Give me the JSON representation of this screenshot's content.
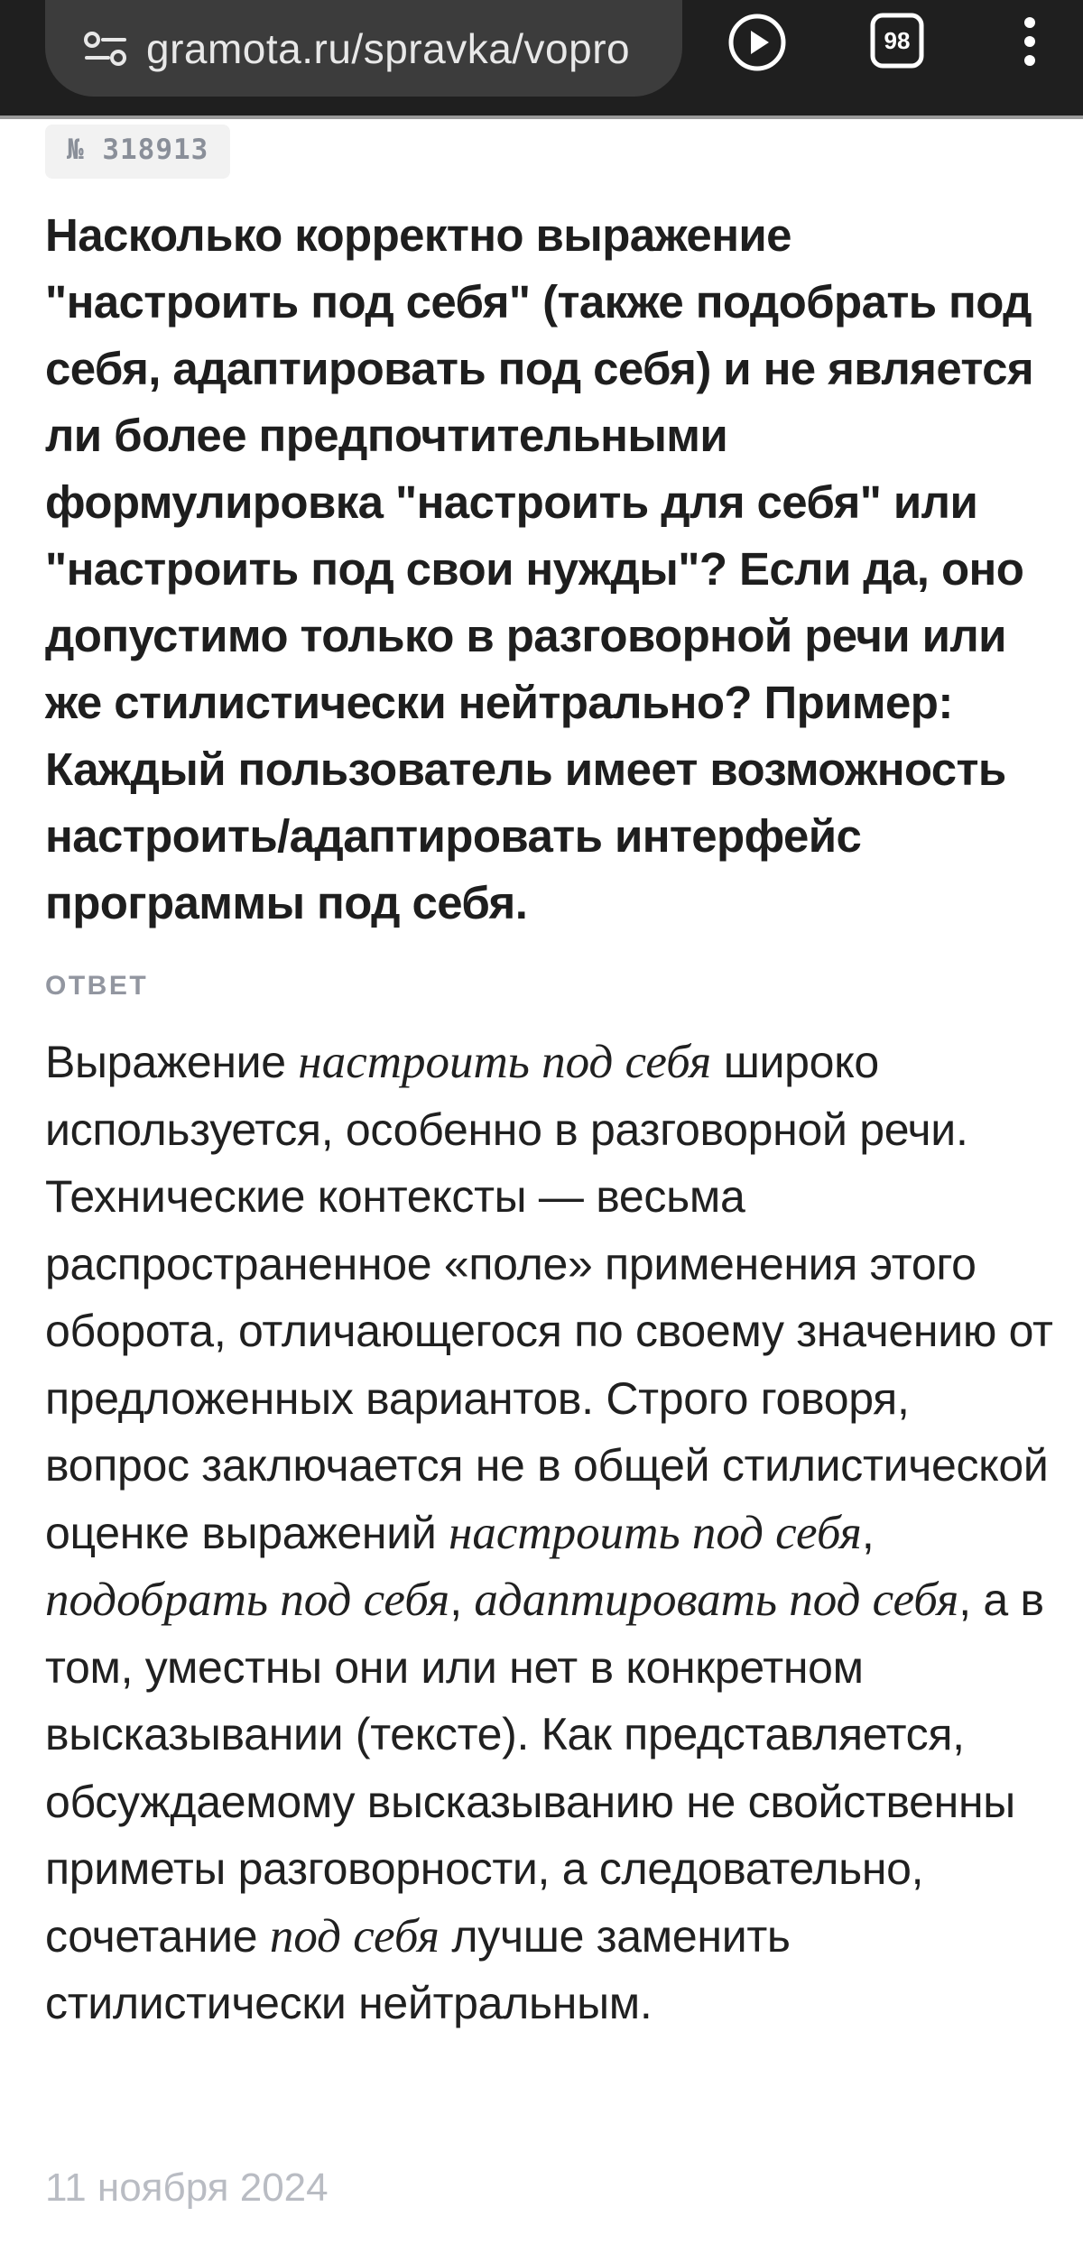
{
  "browser": {
    "url": "gramota.ru/spravka/vopro",
    "tab_count": "98",
    "icons": {
      "site_settings": "tune-icon",
      "play": "play-icon",
      "tabs": "tabs-icon",
      "menu": "more-vert-icon"
    }
  },
  "article": {
    "number": "№ 318913",
    "question": "Насколько корректно выражение \"настроить под себя\" (также подобрать под себя, адаптировать под себя) и не является ли более предпочтительными формулировка \"настроить для себя\" или \"настроить под свои нужды\"? Если да, оно допустимо только в разговорной речи или же стилистически нейтрально? Пример: Каждый пользователь имеет возможность настроить/адаптировать интерфейс программы под себя.",
    "answer_label": "ОТВЕТ",
    "answer": {
      "s1": "Выражение ",
      "i1": "настроить под себя",
      "s2": " широко используется, особенно в разговорной речи. Технические контексты — весьма распространенное «поле» применения этого оборота, отличающегося по своему значению от предложенных вариантов. Строго говоря, вопрос заключается не в общей стилистической оценке выражений ",
      "i2": "настроить под себя",
      "s3": ", ",
      "i3": "подобрать под себя",
      "s4": ", ",
      "i4": "адаптировать под себя",
      "s5": ", а в том, уместны они или нет в конкретном высказывании (тексте). Как представляется, обсуждаемому высказыванию не свойственны приметы разговорности, а следовательно, сочетание ",
      "i5": "под себя",
      "s6": " лучше заменить стилистически нейтральным."
    },
    "date": "11 ноября 2024"
  },
  "colors": {
    "toolbar_bg": "#1f1f1f",
    "urlbar_bg": "#3c3c3c",
    "badge_bg": "#f2f2f2",
    "muted_text": "#9296a0",
    "date_text": "#b9bcc3"
  }
}
